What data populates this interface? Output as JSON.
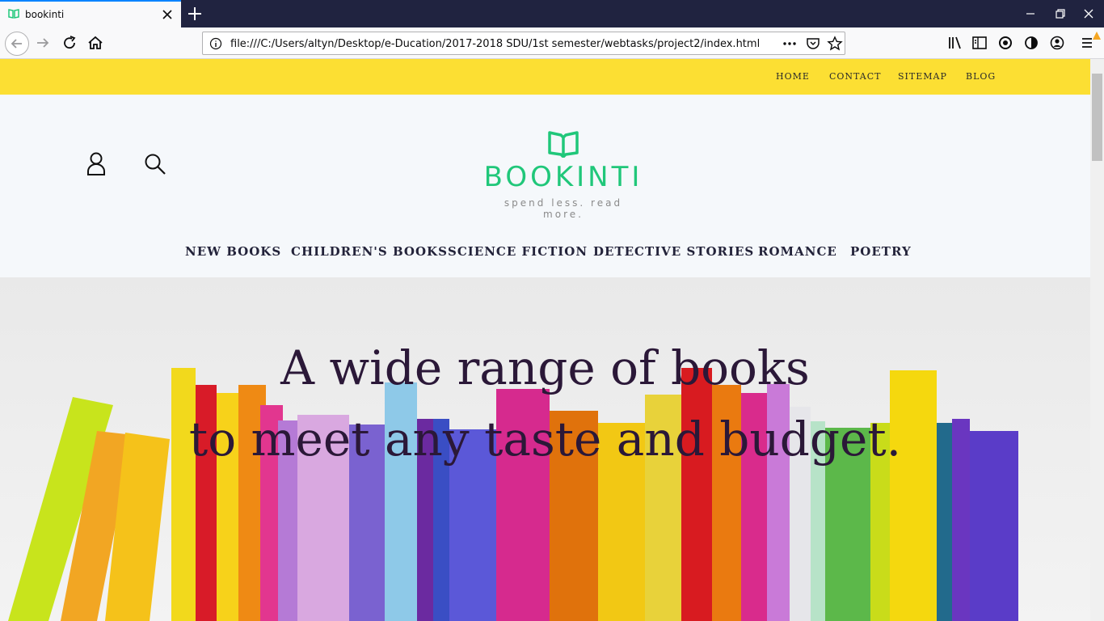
{
  "browser": {
    "tab_title": "bookinti",
    "url": "file:///C:/Users/altyn/Desktop/e-Ducation/2017-2018 SDU/1st semester/webtasks/project2/index.html"
  },
  "topnav": {
    "items": [
      "HOME",
      "CONTACT",
      "SITEMAP",
      "BLOG"
    ]
  },
  "logo": {
    "name": "BOOKINTI",
    "tagline": "spend less. read more.",
    "color": "#20c77a"
  },
  "categories": [
    "NEW BOOKS",
    "CHILDREN'S BOOKS",
    "SCIENCE FICTION",
    "DETECTIVE STORIES",
    "ROMANCE",
    "POETRY"
  ],
  "hero": {
    "line1": "A wide range of books",
    "line2": "to meet any taste and budget."
  },
  "colors": {
    "topbar": "#fcdf33",
    "accent": "#20c77a",
    "hero_text": "#2b1838"
  }
}
